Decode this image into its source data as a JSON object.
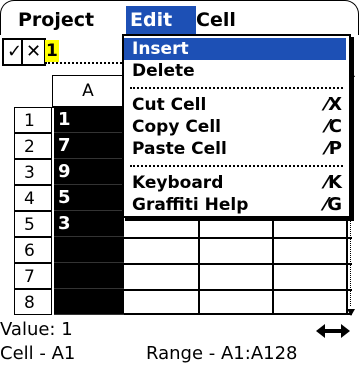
{
  "menubar": {
    "items": [
      "Project",
      "Edit",
      "Cell"
    ],
    "active": "Edit"
  },
  "toolbar": {
    "confirm_icon": "✓",
    "cancel_icon": "✕",
    "edit_value": "1"
  },
  "grid": {
    "column_header": "A",
    "rows": [
      {
        "label": "1",
        "value": "1"
      },
      {
        "label": "2",
        "value": "7"
      },
      {
        "label": "3",
        "value": "9"
      },
      {
        "label": "4",
        "value": "5"
      },
      {
        "label": "5",
        "value": "3"
      },
      {
        "label": "6",
        "value": ""
      },
      {
        "label": "7",
        "value": ""
      },
      {
        "label": "8",
        "value": ""
      }
    ]
  },
  "status": {
    "value_label": "Value: 1",
    "cell_label": "Cell - A1",
    "range_label": "Range - A1:A128"
  },
  "dropdown": {
    "items": [
      {
        "label": "Insert",
        "shortcut": "",
        "highlighted": true
      },
      {
        "label": "Delete",
        "shortcut": "",
        "highlighted": false
      },
      {
        "label": "Cut Cell",
        "shortcut": "⁄X",
        "highlighted": false
      },
      {
        "label": "Copy Cell",
        "shortcut": "⁄C",
        "highlighted": false
      },
      {
        "label": "Paste Cell",
        "shortcut": "⁄P",
        "highlighted": false
      },
      {
        "label": "Keyboard",
        "shortcut": "⁄K",
        "highlighted": false
      },
      {
        "label": "Graffiti Help",
        "shortcut": "⁄G",
        "highlighted": false
      }
    ]
  },
  "colors": {
    "highlight": "#1d50b5",
    "edit_bg": "#ffff00"
  },
  "icons": {
    "scroll": "horizontal-scroll-arrows-icon"
  }
}
